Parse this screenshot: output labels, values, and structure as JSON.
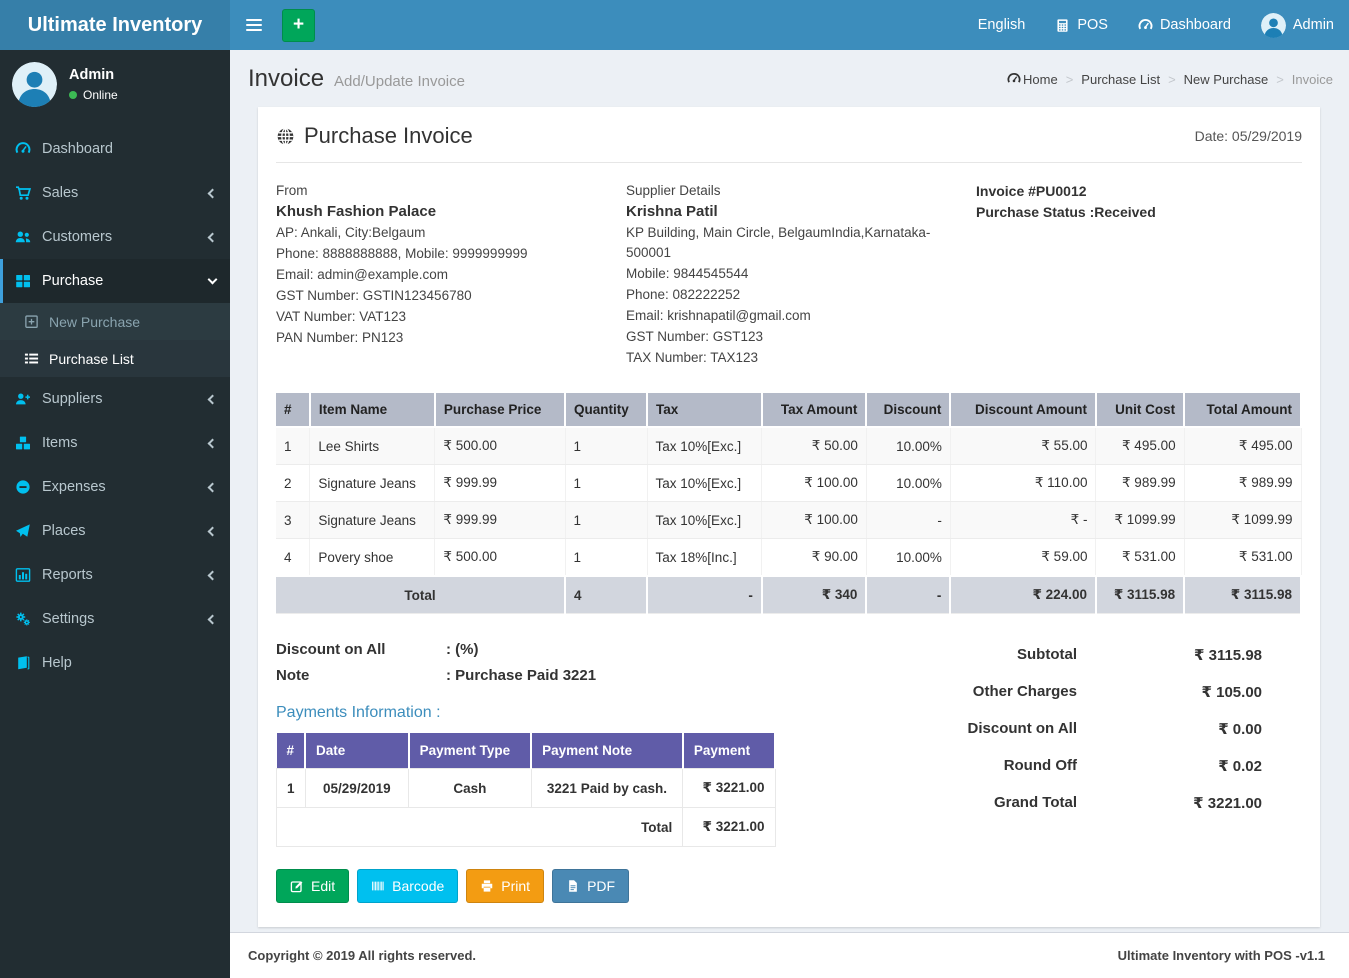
{
  "brand": {
    "title": "Ultimate Inventory"
  },
  "topnav": {
    "add_label": "+",
    "language": "English",
    "pos": "POS",
    "dashboard": "Dashboard",
    "user": "Admin"
  },
  "sidebar": {
    "user": {
      "name": "Admin",
      "status": "Online"
    },
    "items": [
      {
        "label": "Dashboard",
        "icon": "gauge-icon"
      },
      {
        "label": "Sales",
        "icon": "cart-icon",
        "chevron": "left"
      },
      {
        "label": "Customers",
        "icon": "users-icon",
        "chevron": "left"
      },
      {
        "label": "Purchase",
        "icon": "grid-icon",
        "chevron": "down",
        "active": true,
        "submenu": [
          {
            "label": "New Purchase",
            "icon": "plus-square-icon"
          },
          {
            "label": "Purchase List",
            "icon": "list-icon",
            "active": true
          }
        ]
      },
      {
        "label": "Suppliers",
        "icon": "user-plus-icon",
        "chevron": "left"
      },
      {
        "label": "Items",
        "icon": "cubes-icon",
        "chevron": "left"
      },
      {
        "label": "Expenses",
        "icon": "minus-circle-icon",
        "chevron": "left"
      },
      {
        "label": "Places",
        "icon": "paper-plane-icon",
        "chevron": "left"
      },
      {
        "label": "Reports",
        "icon": "bar-chart-icon",
        "chevron": "left"
      },
      {
        "label": "Settings",
        "icon": "gears-icon",
        "chevron": "left"
      },
      {
        "label": "Help",
        "icon": "book-icon"
      }
    ]
  },
  "page": {
    "title": "Invoice",
    "subtitle": "Add/Update Invoice",
    "breadcrumb": [
      {
        "label": "Home",
        "icon": "dashboard-icon"
      },
      {
        "label": "Purchase List"
      },
      {
        "label": "New Purchase"
      },
      {
        "label": "Invoice",
        "current": true
      }
    ]
  },
  "invoice": {
    "heading": "Purchase Invoice",
    "date": "Date: 05/29/2019",
    "from": {
      "label": "From",
      "name": "Khush Fashion Palace",
      "lines": [
        "AP: Ankali, City:Belgaum",
        "Phone: 8888888888, Mobile: 9999999999",
        "Email: admin@example.com",
        "GST Number: GSTIN123456780",
        "VAT Number: VAT123",
        "PAN Number: PN123"
      ]
    },
    "supplier": {
      "label": "Supplier Details",
      "name": "Krishna Patil",
      "lines": [
        "KP Building, Main Circle, BelgaumIndia,Karnataka-500001",
        "Mobile: 9844545544",
        "Phone: 082222252",
        "Email: krishnapatil@gmail.com",
        "GST Number: GST123",
        "TAX Number: TAX123"
      ]
    },
    "meta": {
      "invoice_no": "Invoice #PU0012",
      "status": "Purchase Status :Received"
    },
    "items_table": {
      "headers": [
        "#",
        "Item Name",
        "Purchase Price",
        "Quantity",
        "Tax",
        "Tax Amount",
        "Discount",
        "Discount Amount",
        "Unit Cost",
        "Total Amount"
      ],
      "rows": [
        [
          "1",
          "Lee Shirts",
          "₹ 500.00",
          "1",
          "Tax 10%[Exc.]",
          "₹ 50.00",
          "10.00%",
          "₹ 55.00",
          "₹ 495.00",
          "₹ 495.00"
        ],
        [
          "2",
          "Signature Jeans",
          "₹ 999.99",
          "1",
          "Tax 10%[Exc.]",
          "₹ 100.00",
          "10.00%",
          "₹ 110.00",
          "₹ 989.99",
          "₹ 989.99"
        ],
        [
          "3",
          "Signature Jeans",
          "₹ 999.99",
          "1",
          "Tax 10%[Exc.]",
          "₹ 100.00",
          "-",
          "₹ -",
          "₹ 1099.99",
          "₹ 1099.99"
        ],
        [
          "4",
          "Povery shoe",
          "₹ 500.00",
          "1",
          "Tax 18%[Inc.]",
          "₹ 90.00",
          "10.00%",
          "₹ 59.00",
          "₹ 531.00",
          "₹ 531.00"
        ]
      ],
      "total_row": {
        "label": "Total",
        "quantity": "4",
        "tax": "-",
        "tax_amount": "₹ 340",
        "discount": "-",
        "discount_amount": "₹ 224.00",
        "unit_cost": "₹ 3115.98",
        "total_amount": "₹ 3115.98"
      }
    },
    "discount_on_all": {
      "label": "Discount on All",
      "value": ": (%)"
    },
    "note": {
      "label": "Note",
      "value": ": Purchase Paid 3221"
    },
    "payments": {
      "heading": "Payments Information :",
      "headers": [
        "#",
        "Date",
        "Payment Type",
        "Payment Note",
        "Payment"
      ],
      "rows": [
        [
          "1",
          "05/29/2019",
          "Cash",
          "3221 Paid by cash.",
          "₹ 3221.00"
        ]
      ],
      "total_label": "Total",
      "total_value": "₹ 3221.00"
    },
    "summary": [
      {
        "label": "Subtotal",
        "value": "₹ 3115.98"
      },
      {
        "label": "Other Charges",
        "value": "₹ 105.00"
      },
      {
        "label": "Discount on All",
        "value": "₹ 0.00"
      },
      {
        "label": "Round Off",
        "value": "₹ 0.02"
      },
      {
        "label": "Grand Total",
        "value": "₹ 3221.00"
      }
    ],
    "buttons": [
      {
        "label": "Edit",
        "icon": "edit-icon",
        "color": "#00a65a"
      },
      {
        "label": "Barcode",
        "icon": "barcode-icon",
        "color": "#00c0ef"
      },
      {
        "label": "Print",
        "icon": "print-icon",
        "color": "#f39c12"
      },
      {
        "label": "PDF",
        "icon": "pdf-icon",
        "color": "#4a89b4"
      }
    ]
  },
  "footer": {
    "left": "Copyright © 2019 All rights reserved.",
    "right": "Ultimate Inventory with POS -v1.1"
  },
  "colors": {
    "navbar": "#3c8dbc",
    "logo_bg": "#367fa9",
    "sidebar_bg": "#222d32",
    "sidebar_icon": "#00c0ef",
    "active_border": "#3ea0dc",
    "items_header_bg": "#b4bac8",
    "items_total_bg": "#d2d6de",
    "payments_header_bg": "#605ca8",
    "online_dot": "#3cba54",
    "content_bg": "#ecf0f5"
  }
}
